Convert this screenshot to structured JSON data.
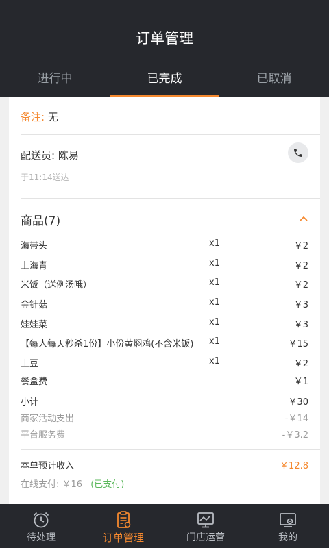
{
  "header": {
    "title": "订单管理",
    "tabs": [
      {
        "label": "进行中"
      },
      {
        "label": "已完成"
      },
      {
        "label": "已取消"
      }
    ]
  },
  "order": {
    "remark_label": "备注:",
    "remark_value": "无",
    "courier": "配送员: 陈易",
    "delivered": "于11:14送达",
    "goods_title": "商品(7)",
    "items": [
      {
        "name": "海带头",
        "qty": "x1",
        "price": "￥2"
      },
      {
        "name": "上海青",
        "qty": "x1",
        "price": "￥2"
      },
      {
        "name": "米饭（送例汤哦）",
        "qty": "x1",
        "price": "￥2"
      },
      {
        "name": "金针菇",
        "qty": "x1",
        "price": "￥3"
      },
      {
        "name": "娃娃菜",
        "qty": "x1",
        "price": "￥3"
      },
      {
        "name": "【每人每天秒杀1份】小份黄焖鸡(不含米饭)",
        "qty": "x1",
        "price": "￥15"
      },
      {
        "name": "土豆",
        "qty": "x1",
        "price": "￥2"
      }
    ],
    "box_fee_label": "餐盒费",
    "box_fee": "￥1",
    "subtotal_label": "小计",
    "subtotal": "￥30",
    "merchant_label": "商家活动支出",
    "merchant": "-￥14",
    "platform_label": "平台服务费",
    "platform": "-￥3.2",
    "income_label": "本单预计收入",
    "income": "￥12.8",
    "payment_label": "在线支付: ￥16",
    "payment_status": "(已支付)"
  },
  "tabbar": [
    {
      "label": "待处理",
      "icon": "alarm-clock-icon"
    },
    {
      "label": "订单管理",
      "icon": "clipboard-icon"
    },
    {
      "label": "门店运营",
      "icon": "monitor-chart-icon"
    },
    {
      "label": "我的",
      "icon": "gear-box-icon"
    }
  ],
  "colors": {
    "accent": "#f5892f",
    "dark": "#26282d",
    "paid_green": "#5cb85c"
  }
}
